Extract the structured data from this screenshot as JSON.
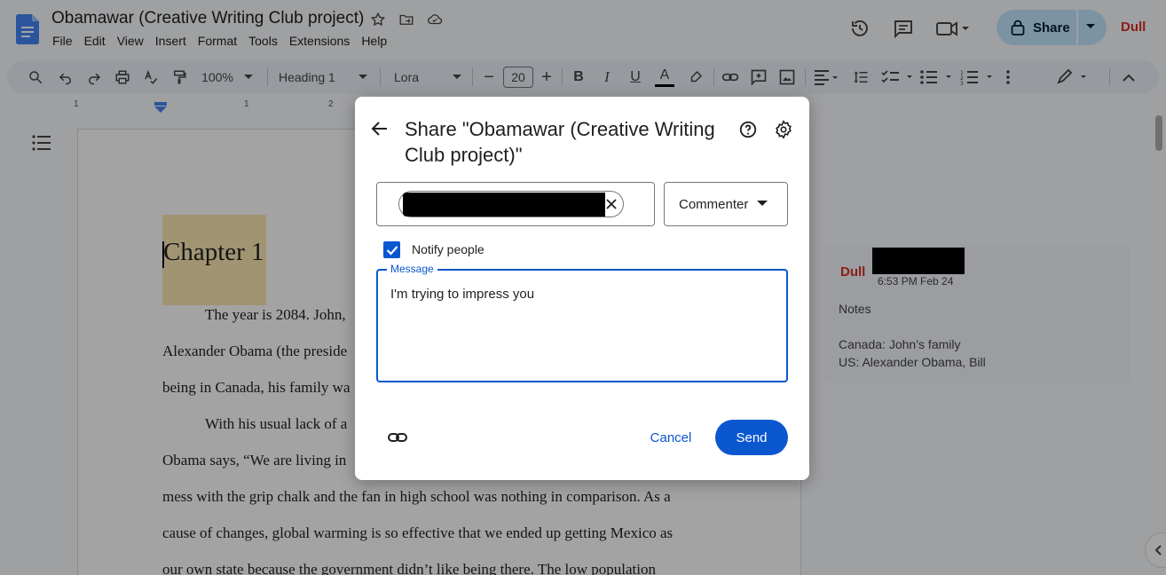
{
  "doc": {
    "title": "Obamawar (Creative Writing Club project)",
    "menu": [
      "File",
      "Edit",
      "View",
      "Insert",
      "Format",
      "Tools",
      "Extensions",
      "Help"
    ]
  },
  "header": {
    "share_label": "Share",
    "user_logo": "Dull"
  },
  "toolbar": {
    "zoom": "100%",
    "style": "Heading 1",
    "font": "Lora",
    "font_size": "20",
    "bold": "B",
    "italic": "I",
    "underline": "U",
    "text_color": "A"
  },
  "ruler": {
    "labels": [
      "1",
      "1",
      "2"
    ]
  },
  "document": {
    "heading": "Chapter 1",
    "lines": [
      "The year is 2084. John,",
      "Alexander Obama (the preside",
      "being in Canada, his family wa",
      "With his usual lack of a",
      "Obama says, “We are living in",
      "mess with the grip chalk and the fan in high school was nothing in comparison. As a",
      "cause of changes, global warming is so effective that we ended up getting Mexico as",
      "our own state because the government didn’t like being there. The low population"
    ]
  },
  "comment": {
    "author_logo": "Dull",
    "time": "6:53 PM Feb 24",
    "title": "Notes",
    "line1": "Canada: John’s family",
    "line2": "US: Alexander Obama, Bill"
  },
  "dialog": {
    "title": "Share \"Obamawar (Creative Writing Club project)\"",
    "role": "Commenter",
    "notify_label": "Notify people",
    "notify_checked": true,
    "message_label": "Message",
    "message_value": "I'm trying to impress you",
    "cancel_label": "Cancel",
    "send_label": "Send"
  },
  "colors": {
    "accent": "#0b57d0",
    "share_button": "#c2e7ff",
    "brand_red": "#d93025",
    "highlight": "#fce8b2"
  },
  "icons": [
    "docs-icon",
    "star-icon",
    "folder-move-icon",
    "cloud-status-icon",
    "history-icon",
    "comment-icon",
    "meet-icon",
    "lock-icon",
    "search-icon",
    "undo-icon",
    "redo-icon",
    "print-icon",
    "spellcheck-icon",
    "paint-format-icon",
    "link-icon",
    "add-comment-icon",
    "image-icon",
    "align-icon",
    "line-spacing-icon",
    "checklist-icon",
    "bullet-list-icon",
    "numbered-list-icon",
    "more-icon",
    "edit-mode-icon",
    "collapse-icon",
    "outline-icon",
    "back-arrow-icon",
    "help-icon",
    "gear-icon",
    "close-icon",
    "chevron-down-icon",
    "check-icon"
  ]
}
